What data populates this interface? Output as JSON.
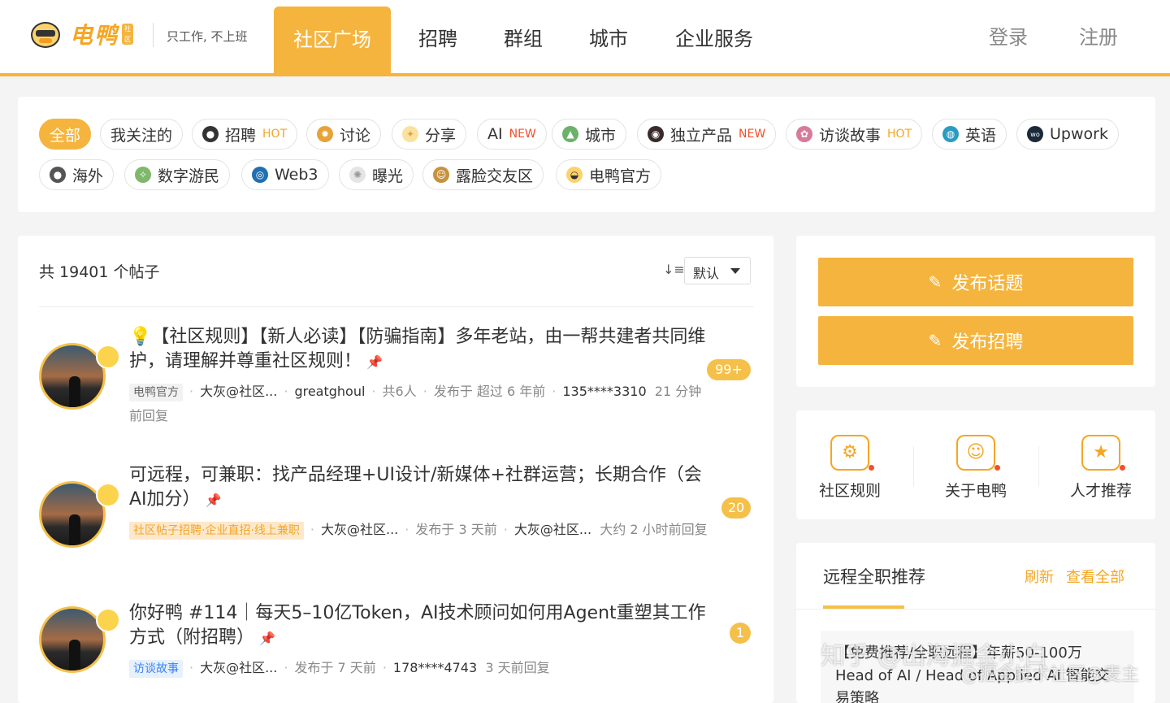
{
  "header": {
    "logo_text": "电鸭",
    "logo_badge": "社区",
    "slogan": "只工作, 不上班",
    "nav": [
      "社区广场",
      "招聘",
      "群组",
      "城市",
      "企业服务"
    ],
    "login": "登录",
    "register": "注册"
  },
  "categories": {
    "row1": [
      {
        "label": "全部",
        "icon": ""
      },
      {
        "label": "我关注的",
        "icon": ""
      },
      {
        "label": "招聘",
        "icon": "user-icon",
        "tag": "HOT"
      },
      {
        "label": "讨论",
        "icon": "gear-icon"
      },
      {
        "label": "分享",
        "icon": "sparkle-icon"
      },
      {
        "label": "AI",
        "icon": "",
        "tag": "NEW"
      },
      {
        "label": "城市",
        "icon": "city-icon"
      },
      {
        "label": "独立产品",
        "icon": "product-icon",
        "tag": "NEW"
      },
      {
        "label": "访谈故事",
        "icon": "interview-icon",
        "tag": "HOT"
      },
      {
        "label": "英语",
        "icon": "globe-icon"
      },
      {
        "label": "Upwork",
        "icon": "upwork-icon"
      }
    ],
    "row2": [
      {
        "label": "海外",
        "icon": "overseas-icon"
      },
      {
        "label": "数字游民",
        "icon": "nomad-icon"
      },
      {
        "label": "Web3",
        "icon": "web3-icon"
      },
      {
        "label": "曝光",
        "icon": "exposure-icon"
      },
      {
        "label": "露脸交友区",
        "icon": "face-icon"
      },
      {
        "label": "电鸭官方",
        "icon": "duck-icon"
      }
    ]
  },
  "list": {
    "count_text": "共 19401 个帖子",
    "sort_value": "默认",
    "posts": [
      {
        "bulb": "💡",
        "title": "【社区规则】【新人必读】【防骗指南】多年老站，由一帮共建者共同维护，请理解并尊重社区规则！",
        "tag": "电鸭官方",
        "author": "大灰@社区...",
        "last": "greatghoul",
        "people": "共6人",
        "time": "发布于 超过 6 年前",
        "phone": "135****3310",
        "reply_time": "21 分钟前回复",
        "replies": "99+"
      },
      {
        "title": "可远程，可兼职：找产品经理+UI设计/新媒体+社群运营；长期合作（会AI加分）",
        "tag": "社区帖子招聘·企业直招·线上兼职",
        "author": "大灰@社区...",
        "time": "发布于 3 天前",
        "last": "大灰@社区...",
        "reply_time": "大约 2 小时前回复",
        "replies": "20"
      },
      {
        "title": "你好鸭 #114｜每天5–10亿Token，AI技术顾问如何用Agent重塑其工作方式（附招聘）",
        "tag": "访谈故事",
        "author": "大灰@社区...",
        "time": "发布于 7 天前",
        "phone": "178****4743",
        "reply_time": "3 天前回复",
        "replies": "1"
      }
    ]
  },
  "sidebar": {
    "btn_topic": "发布话题",
    "btn_job": "发布招聘",
    "quick_links": [
      "社区规则",
      "关于电鸭",
      "人才推荐"
    ],
    "remote_title": "远程全职推荐",
    "refresh": "刷新",
    "view_all": "查看全部",
    "card_text": "【免费推荐/全职远程】年薪50-100万 Head of AI / Head of Applied AI 智能交易策略"
  },
  "watermark": {
    "line1": "知乎 @出海掘金小白",
    "line2": "@掘金技术社区@麦主"
  }
}
